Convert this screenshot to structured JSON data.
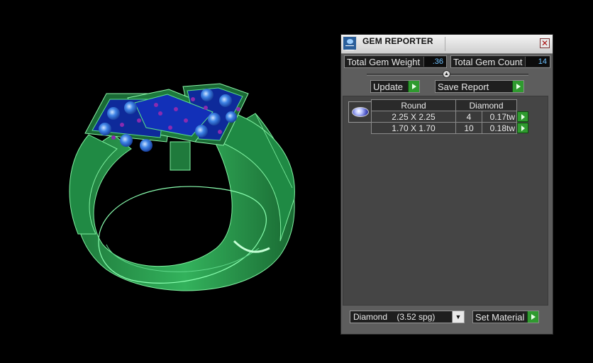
{
  "window": {
    "title": "GEM REPORTER",
    "close_icon": "close-icon",
    "app_icon": "gem-reporter-icon"
  },
  "stats": {
    "weight_label": "Total Gem Weight",
    "weight_value": ".36",
    "count_label": "Total Gem Count",
    "count_value": "14"
  },
  "actions": {
    "update_label": "Update",
    "save_report_label": "Save Report"
  },
  "gem_table": {
    "headers": [
      "Round",
      "Diamond"
    ],
    "rows": [
      {
        "size": "2.25 X 2.25",
        "count": "4",
        "weight": "0.17tw"
      },
      {
        "size": "1.70 X 1.70",
        "count": "10",
        "weight": "0.18tw"
      }
    ]
  },
  "material": {
    "selected": "Diamond    (3.52 spg)",
    "set_label": "Set Material"
  },
  "colors": {
    "ring": "#3fbf6a",
    "stone": "#1f5bd1",
    "accent": "#2f9a2f",
    "value_text": "#6fc2ff"
  }
}
